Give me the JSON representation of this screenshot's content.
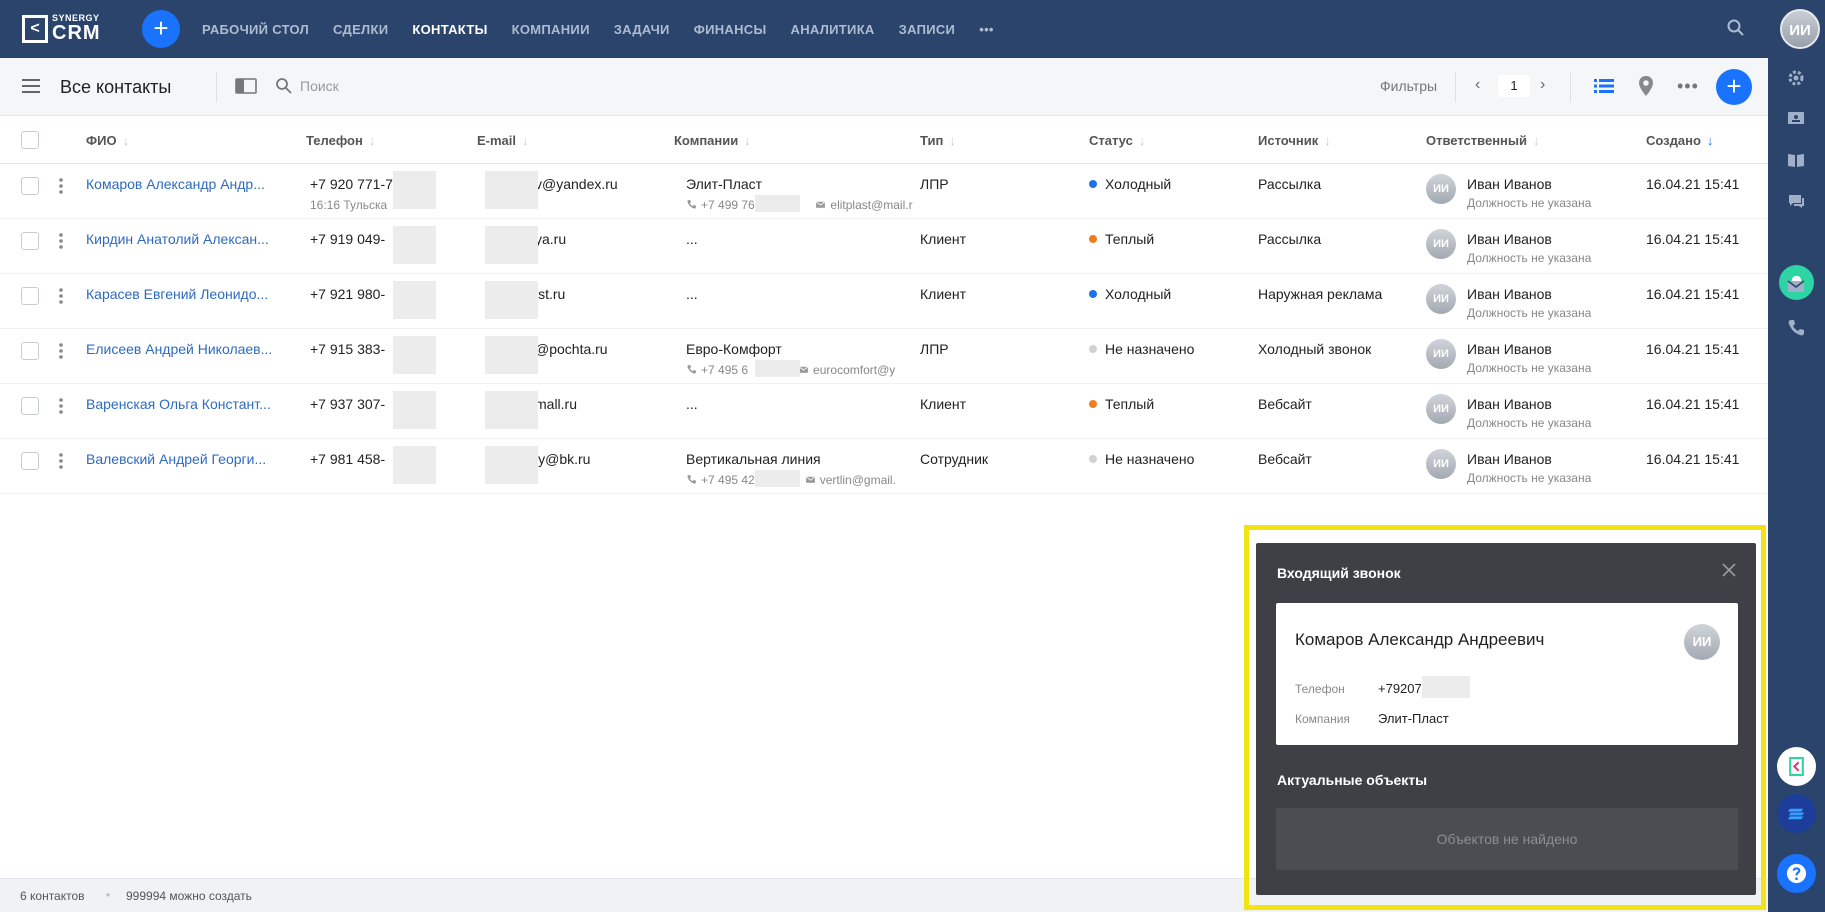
{
  "app": {
    "logo_small": "SYNERGY",
    "logo_big": "CRM",
    "logo_mark": "<",
    "accent": "#1a73ff",
    "nav_bg": "#2a446b"
  },
  "nav": {
    "items": [
      "РАБОЧИЙ СТОЛ",
      "СДЕЛКИ",
      "КОНТАКТЫ",
      "КОМПАНИИ",
      "ЗАДАЧИ",
      "ФИНАНСЫ",
      "АНАЛИТИКА",
      "ЗАПИСИ"
    ],
    "active": "КОНТАКТЫ",
    "more": "•••",
    "avatar": "ИИ"
  },
  "toolbar": {
    "title": "Все контакты",
    "search_placeholder": "Поиск",
    "filters": "Фильтры",
    "page": "1",
    "prev": "‹",
    "next": "›",
    "more": "•••",
    "add": "+"
  },
  "table": {
    "headers": {
      "fio": "ФИО",
      "phone": "Телефон",
      "email": "E-mail",
      "companies": "Компании",
      "type": "Тип",
      "status": "Статус",
      "source": "Источник",
      "responsible": "Ответственный",
      "created": "Создано"
    },
    "sort_arrow": "↓",
    "rows": [
      {
        "name": "Комаров Александр Андр...",
        "phone": "+7 920 771-7",
        "phone_sub": "16:16 Тульска",
        "email": "v@yandex.ru",
        "company": "Элит-Пласт",
        "company_phone": "+7 499 761-",
        "company_email": "elitplast@mail.r",
        "type": "ЛПР",
        "status": "Холодный",
        "status_color": "#1a73e8",
        "source": "Рассылка",
        "resp_name": "Иван Иванов",
        "resp_pos": "Должность не указана",
        "resp_avatar": "ИИ",
        "created": "16.04.21 15:41"
      },
      {
        "name": "Кирдин Анатолий Алексан...",
        "phone": "+7 919 049-",
        "phone_sub": "",
        "email": "ya.ru",
        "company": "...",
        "company_phone": "",
        "company_email": "",
        "type": "Клиент",
        "status": "Теплый",
        "status_color": "#ef7d22",
        "source": "Рассылка",
        "resp_name": "Иван Иванов",
        "resp_pos": "Должность не указана",
        "resp_avatar": "ИИ",
        "created": "16.04.21 15:41"
      },
      {
        "name": "Карасев Евгений Леонидо...",
        "phone": "+7 921 980-",
        "phone_sub": "",
        "email": "lst.ru",
        "company": "...",
        "company_phone": "",
        "company_email": "",
        "type": "Клиент",
        "status": "Холодный",
        "status_color": "#1a73e8",
        "source": "Наружная реклама",
        "resp_name": "Иван Иванов",
        "resp_pos": "Должность не указана",
        "resp_avatar": "ИИ",
        "created": "16.04.21 15:41"
      },
      {
        "name": "Елисеев Андрей Николаев...",
        "phone": "+7 915 383-",
        "phone_sub": "",
        "email": "@pochta.ru",
        "company": "Евро-Комфорт",
        "company_phone": "+7 495 6",
        "company_email": "eurocomfort@y",
        "type": "ЛПР",
        "status": "Не назначено",
        "status_color": "#d0d2d6",
        "source": "Холодный звонок",
        "resp_name": "Иван Иванов",
        "resp_pos": "Должность не указана",
        "resp_avatar": "ИИ",
        "created": "16.04.21 15:41"
      },
      {
        "name": "Варенская Ольга Констант...",
        "phone": "+7 937 307-",
        "phone_sub": "",
        "email": "mall.ru",
        "company": "...",
        "company_phone": "",
        "company_email": "",
        "type": "Клиент",
        "status": "Теплый",
        "status_color": "#ef7d22",
        "source": "Вебсайт",
        "resp_name": "Иван Иванов",
        "resp_pos": "Должность не указана",
        "resp_avatar": "ИИ",
        "created": "16.04.21 15:41"
      },
      {
        "name": "Валевский Андрей Георги...",
        "phone": "+7 981 458-",
        "phone_sub": "",
        "email": "ly@bk.ru",
        "company": "Вертикальная линия",
        "company_phone": "+7 495 42",
        "company_email": "vertlin@gmail.",
        "type": "Сотрудник",
        "status": "Не назначено",
        "status_color": "#d0d2d6",
        "source": "Вебсайт",
        "resp_name": "Иван Иванов",
        "resp_pos": "Должность не указана",
        "resp_avatar": "ИИ",
        "created": "16.04.21 15:41"
      }
    ]
  },
  "footer": {
    "count": "6 контактов",
    "separator": "•",
    "can_create": "999994 можно создать"
  },
  "call": {
    "title": "Входящий звонок",
    "contact_name": "Комаров Александр Андреевич",
    "avatar": "ИИ",
    "phone_label": "Телефон",
    "phone_value": "+79207",
    "company_label": "Компания",
    "company_value": "Элит-Пласт",
    "objects_title": "Актуальные объекты",
    "objects_empty": "Объектов не найдено",
    "highlight_color": "#f2e313"
  },
  "icons": {
    "nav": [
      "search-icon",
      "plus-icon"
    ],
    "rightbar": [
      "gear-icon",
      "contact-card-icon",
      "book-icon",
      "chat-icon",
      "bell-icon",
      "mail-icon",
      "phone-icon",
      "bracket-app-icon",
      "stack-app-icon",
      "help-icon"
    ]
  }
}
